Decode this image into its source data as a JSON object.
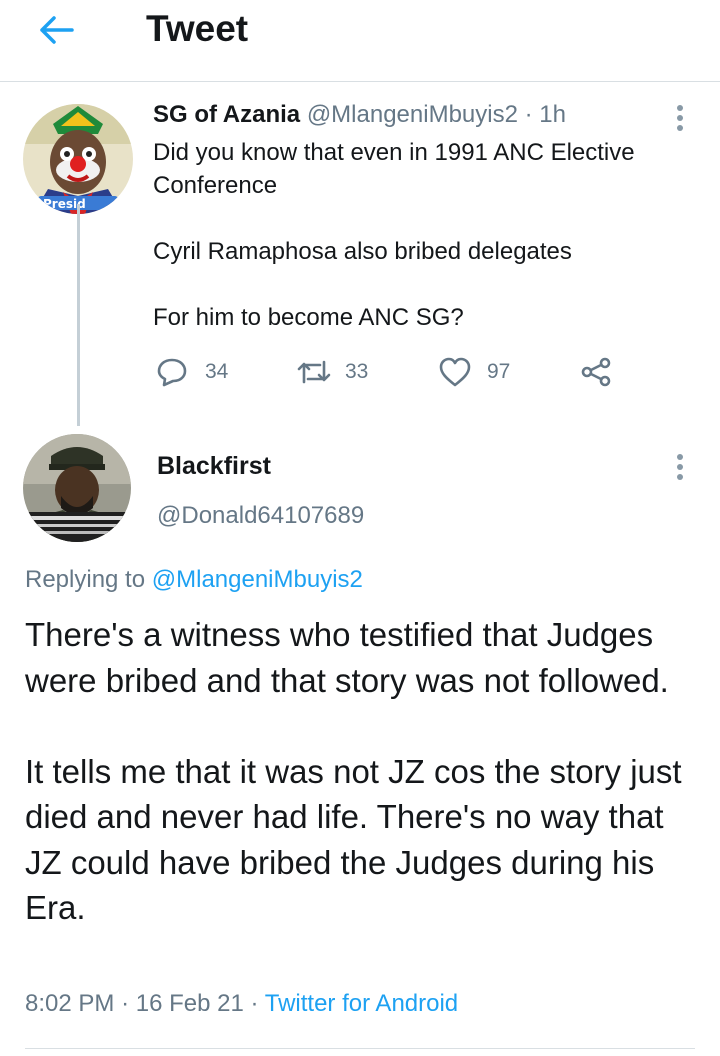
{
  "header": {
    "title": "Tweet",
    "back_icon": "arrow-left-icon",
    "accent": "#1da1f2"
  },
  "parent_tweet": {
    "name": "SG of Azania",
    "handle": "@MlangeniMbuyis2",
    "separator": "·",
    "time": "1h",
    "avatar_text": "Presid",
    "text": {
      "line1": "Did you know that even in 1991 ANC Elective",
      "line2": "Conference",
      "para2": "Cyril Ramaphosa also bribed delegates",
      "para3": "For him to become ANC SG?"
    },
    "actions": {
      "replies": "34",
      "retweets": "33",
      "likes": "97"
    }
  },
  "reply_tweet": {
    "name": "Blackfirst",
    "handle": "@Donald64107689",
    "replying_prefix": "Replying to",
    "replying_to": "@MlangeniMbuyis2",
    "para1": "There's a witness who testified that Judges were bribed and that story was not followed.",
    "para2": "It tells me that it was not JZ cos the story just died and never had life. There's no way that JZ could have bribed the Judges during his Era.",
    "time": "8:02 PM",
    "separator": "·",
    "date": "16 Feb 21",
    "separator2": "·",
    "source": "Twitter for Android"
  },
  "colors": {
    "link": "#1da1f2",
    "secondary": "#657786",
    "primary": "#14171a",
    "divider": "#d9dfe3"
  }
}
